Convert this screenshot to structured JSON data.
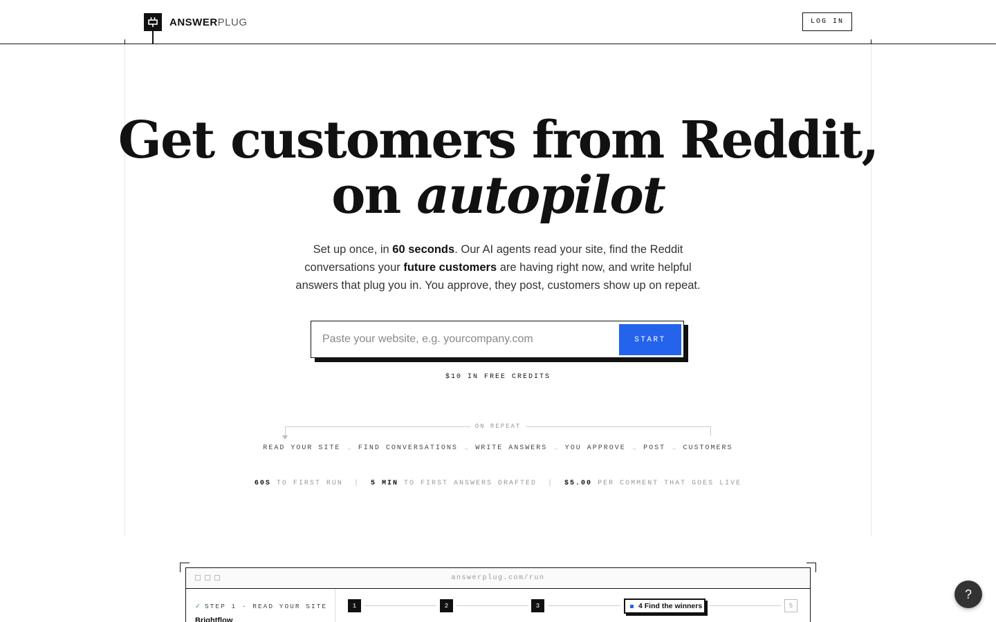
{
  "header": {
    "brand_bold": "ANSWER",
    "brand_light": "PLUG",
    "login_label": "LOG IN"
  },
  "hero": {
    "headline_line1": "Get customers from Reddit,",
    "headline_on": "on ",
    "headline_italic": "autopilot",
    "sub_1": "Set up once, in ",
    "sub_2": "60 seconds",
    "sub_3": ". Our AI agents read your site, find the Reddit conversations your ",
    "sub_4": "future customers",
    "sub_5": " are having right now, and write helpful answers that plug you in. You approve, they post, customers show up on repeat."
  },
  "form": {
    "placeholder": "Paste your website, e.g. yourcompany.com",
    "value": "",
    "start_label": "START",
    "credits": "$10 IN FREE CREDITS"
  },
  "loop": {
    "label": "ON REPEAT",
    "steps": [
      "READ YOUR SITE",
      "FIND CONVERSATIONS",
      "WRITE ANSWERS",
      "YOU APPROVE",
      "POST",
      "CUSTOMERS"
    ],
    "arrow": "→"
  },
  "stats": [
    {
      "value": "60S",
      "label": "TO FIRST RUN"
    },
    {
      "value": "5 MIN",
      "label": "TO FIRST ANSWERS DRAFTED"
    },
    {
      "value": "$5.00",
      "label": "PER COMMENT THAT GOES LIVE"
    }
  ],
  "preview": {
    "url": "answerplug.com/run",
    "check": "✓",
    "step_label": "STEP 1 · READ YOUR SITE",
    "brand": "Brightflow",
    "steps": [
      "1",
      "2",
      "3",
      "4"
    ],
    "active_label": "Find the winners",
    "last_step": "5"
  },
  "help_label": "?",
  "colors": {
    "accent": "#2463eb",
    "ink": "#111111",
    "check": "#2a9d5c"
  }
}
